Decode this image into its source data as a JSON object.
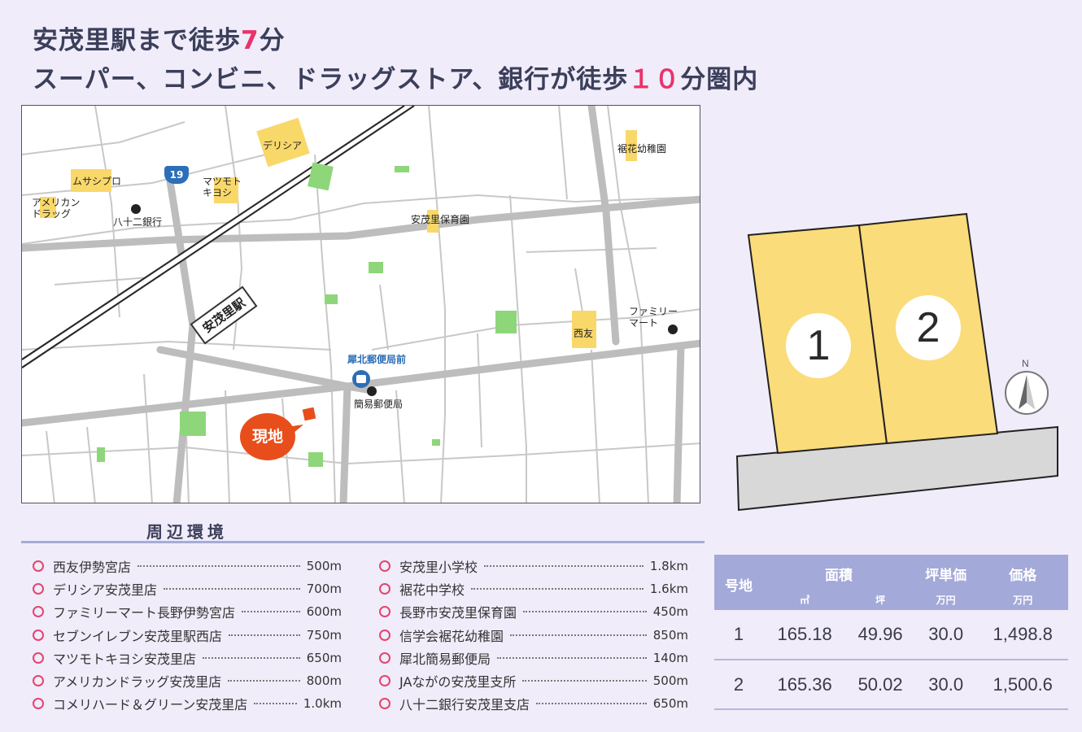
{
  "headline": {
    "line1_pre": "安茂里駅まで徒歩",
    "line1_num": "7",
    "line1_post": "分",
    "line2_pre": "スーパー、コンビニ、ドラッグストア、銀行が徒歩",
    "line2_num": "１０",
    "line2_post": "分圏内"
  },
  "map": {
    "station": "安茂里駅",
    "route": "19",
    "genchi": "現地",
    "labels": {
      "delicia": "デリシア",
      "musashi": "ムサシプロ",
      "american": "アメリカン\nドラッグ",
      "matsumoto": "マツモト\nキヨシ",
      "bank": "八十二銀行",
      "kindergarten": "裾花幼稚園",
      "nursery": "安茂里保育園",
      "famima": "ファミリー\nマート",
      "seiyu": "西友",
      "bus_stop": "犀北郵便局前",
      "post": "簡易郵便局"
    }
  },
  "lots": {
    "lot1": "1",
    "lot2": "2",
    "north": "N"
  },
  "environment": {
    "title": "周辺環境",
    "left": [
      {
        "name": "西友伊勢宮店",
        "dist": "500m"
      },
      {
        "name": "デリシア安茂里店",
        "dist": "700m"
      },
      {
        "name": "ファミリーマート長野伊勢宮店",
        "dist": "600m"
      },
      {
        "name": "セブンイレブン安茂里駅西店",
        "dist": "750m"
      },
      {
        "name": "マツモトキヨシ安茂里店",
        "dist": "650m"
      },
      {
        "name": "アメリカンドラッグ安茂里店",
        "dist": "800m"
      },
      {
        "name": "コメリハード＆グリーン安茂里店",
        "dist": "1.0km"
      }
    ],
    "right": [
      {
        "name": "安茂里小学校",
        "dist": "1.8km"
      },
      {
        "name": "裾花中学校",
        "dist": "1.6km"
      },
      {
        "name": "長野市安茂里保育園",
        "dist": "450m"
      },
      {
        "name": "信学会裾花幼稚園",
        "dist": "850m"
      },
      {
        "name": "犀北簡易郵便局",
        "dist": "140m"
      },
      {
        "name": "JAながの安茂里支所",
        "dist": "500m"
      },
      {
        "name": "八十二銀行安茂里支店",
        "dist": "650m"
      }
    ]
  },
  "price_table": {
    "headers": {
      "lot": "号地",
      "area": "面積",
      "tsubo_price": "坪単価",
      "price": "価格"
    },
    "subheaders": {
      "sqm": "㎡",
      "tsubo": "坪",
      "man_yen_1": "万円",
      "man_yen_2": "万円"
    },
    "rows": [
      {
        "lot": "1",
        "sqm": "165.18",
        "tsubo": "49.96",
        "unit": "30.0",
        "price": "1,498.8"
      },
      {
        "lot": "2",
        "sqm": "165.36",
        "tsubo": "50.02",
        "unit": "30.0",
        "price": "1,500.6"
      }
    ]
  }
}
